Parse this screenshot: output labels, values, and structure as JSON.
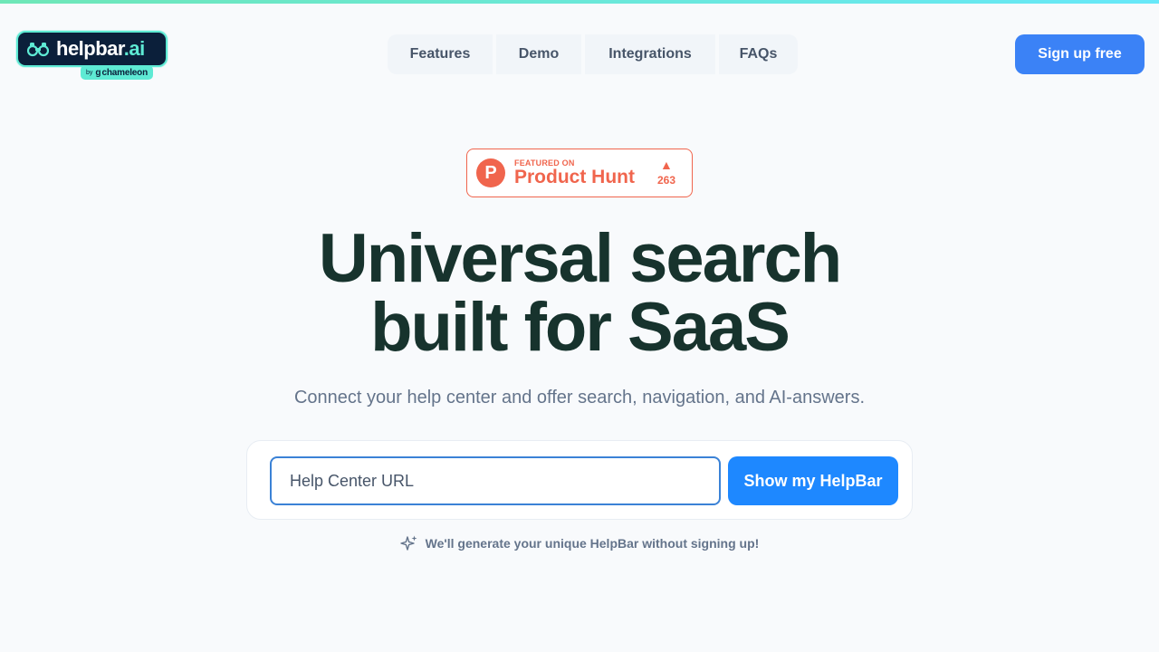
{
  "brand": {
    "name_main": "helpbar",
    "name_suffix": ".ai",
    "badge_by": "by",
    "badge_brand": "chameleon",
    "colors": {
      "navy": "#0b1f3a",
      "teal": "#5eead4"
    }
  },
  "nav": {
    "items": [
      {
        "label": "Features"
      },
      {
        "label": "Demo"
      },
      {
        "label": "Integrations"
      },
      {
        "label": "FAQs"
      }
    ]
  },
  "header": {
    "signup_label": "Sign up free"
  },
  "product_hunt": {
    "featured_on": "FEATURED ON",
    "name": "Product Hunt",
    "votes": "263",
    "logo_letter": "P",
    "color": "#f0654d"
  },
  "hero": {
    "title_line1": "Universal search",
    "title_line2": "built for SaaS",
    "subtitle": "Connect your help center and offer search, navigation, and AI-answers."
  },
  "search": {
    "placeholder": "Help Center URL",
    "button_label": "Show my HelpBar",
    "hint": "We'll generate your unique HelpBar without signing up!"
  },
  "colors": {
    "accent": "#3b82f6",
    "primary_button": "#1e88ff",
    "title": "#17332d",
    "muted": "#64748b"
  }
}
